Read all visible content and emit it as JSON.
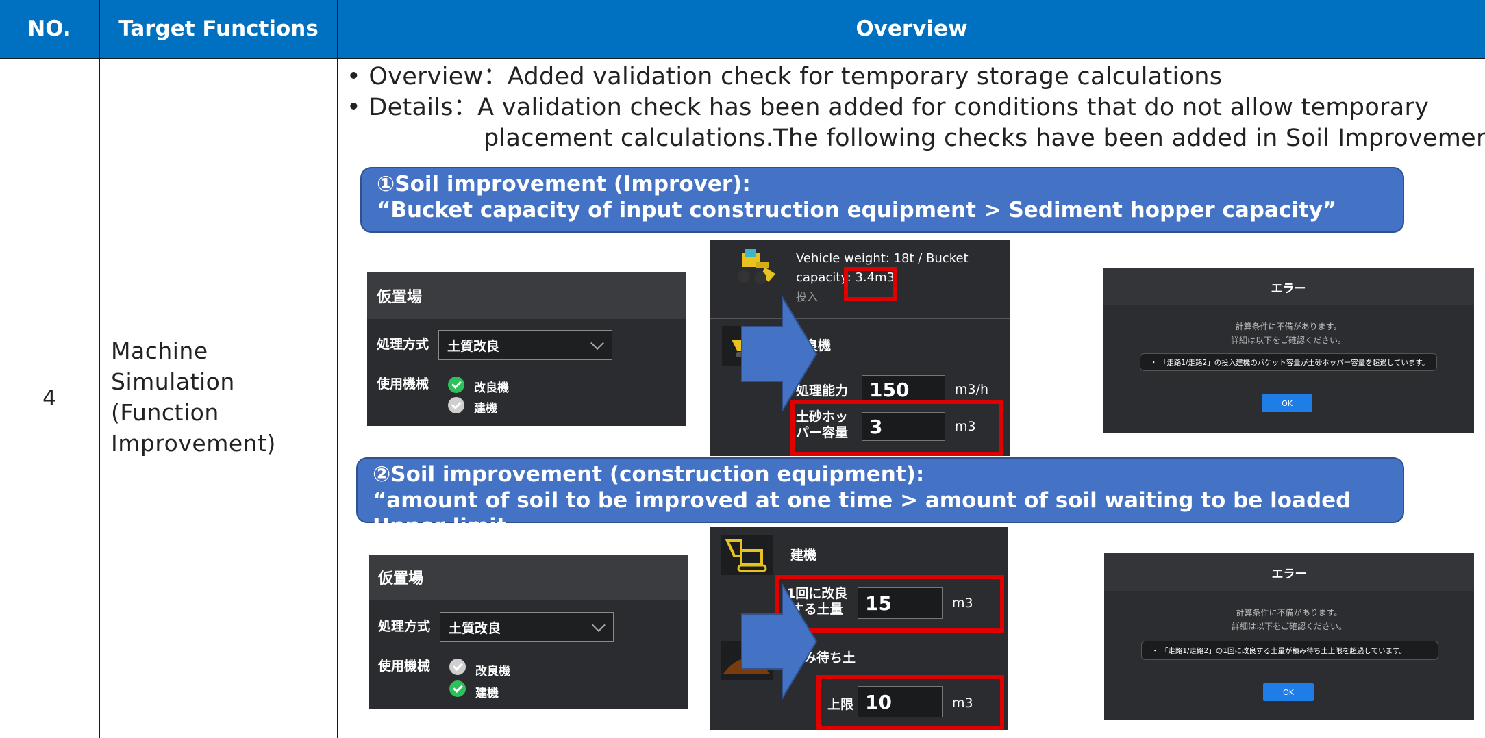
{
  "table": {
    "headers": [
      "NO.",
      "Target Functions",
      "Overview"
    ],
    "row": {
      "no": "4",
      "function_lines": [
        "Machine",
        "Simulation",
        "(Function",
        "Improvement)"
      ]
    }
  },
  "overview": {
    "bullet1": "• Overview：Added validation check for temporary storage calculations",
    "bullet2": "• Details：A validation check has been added for conditions that do not allow temporary",
    "bullet2_cont": "placement calculations.The following checks have been added in Soil Improvement"
  },
  "section1": {
    "banner_line1": "①Soil improvement (Improver):",
    "banner_line2": "“Bucket capacity of input construction equipment > Sediment hopper capacity”",
    "storage_panel": {
      "title": "仮置場",
      "method_label": "処理方式",
      "method_value": "土質改良",
      "machine_label": "使用機械",
      "items": [
        {
          "label": "改良機",
          "checked": true
        },
        {
          "label": "建機",
          "checked": false
        }
      ]
    },
    "vehicle_line1": "Vehicle weight: 18t / Bucket",
    "vehicle_line2": "capacity: 3.4m3",
    "vehicle_sub": "投入",
    "improver_label": "改良機",
    "capacity_label": "処理能力",
    "capacity_value": "150",
    "capacity_unit": "m3/h",
    "hopper_label_1": "土砂ホッ",
    "hopper_label_2": "パー容量",
    "hopper_value": "3",
    "hopper_unit": "m3",
    "error": {
      "title": "エラー",
      "line1": "計算条件に不備があります。",
      "line2": "詳細は以下をご確認ください。",
      "message": "・ 「走路1/走路2」の投入建機のバケット容量が土砂ホッパー容量を超過しています。",
      "ok": "OK"
    }
  },
  "section2": {
    "banner_line1": "②Soil improvement (construction equipment):",
    "banner_line2": "“amount of soil to be improved at one time > amount of soil waiting to be loaded Upper limit",
    "storage_panel": {
      "title": "仮置場",
      "method_label": "処理方式",
      "method_value": "土質改良",
      "machine_label": "使用機械",
      "items": [
        {
          "label": "改良機",
          "checked": false
        },
        {
          "label": "建機",
          "checked": true
        }
      ]
    },
    "equip_label": "建機",
    "once_label_1": "1回に改良",
    "once_label_2": "する土量",
    "once_value": "15",
    "once_unit": "m3",
    "waiting_label": "積み待ち土",
    "limit_label": "上限",
    "limit_value": "10",
    "limit_unit": "m3",
    "error": {
      "title": "エラー",
      "line1": "計算条件に不備があります。",
      "line2": "詳細は以下をご確認ください。",
      "message": "・ 「走路1/走路2」の1回に改良する土量が積み待ち土上限を超過しています。",
      "ok": "OK"
    }
  },
  "colors": {
    "header_bg": "#0070C0",
    "banner_bg": "#4472C4",
    "highlight": "#e00000",
    "arrow": "#4472C4"
  }
}
